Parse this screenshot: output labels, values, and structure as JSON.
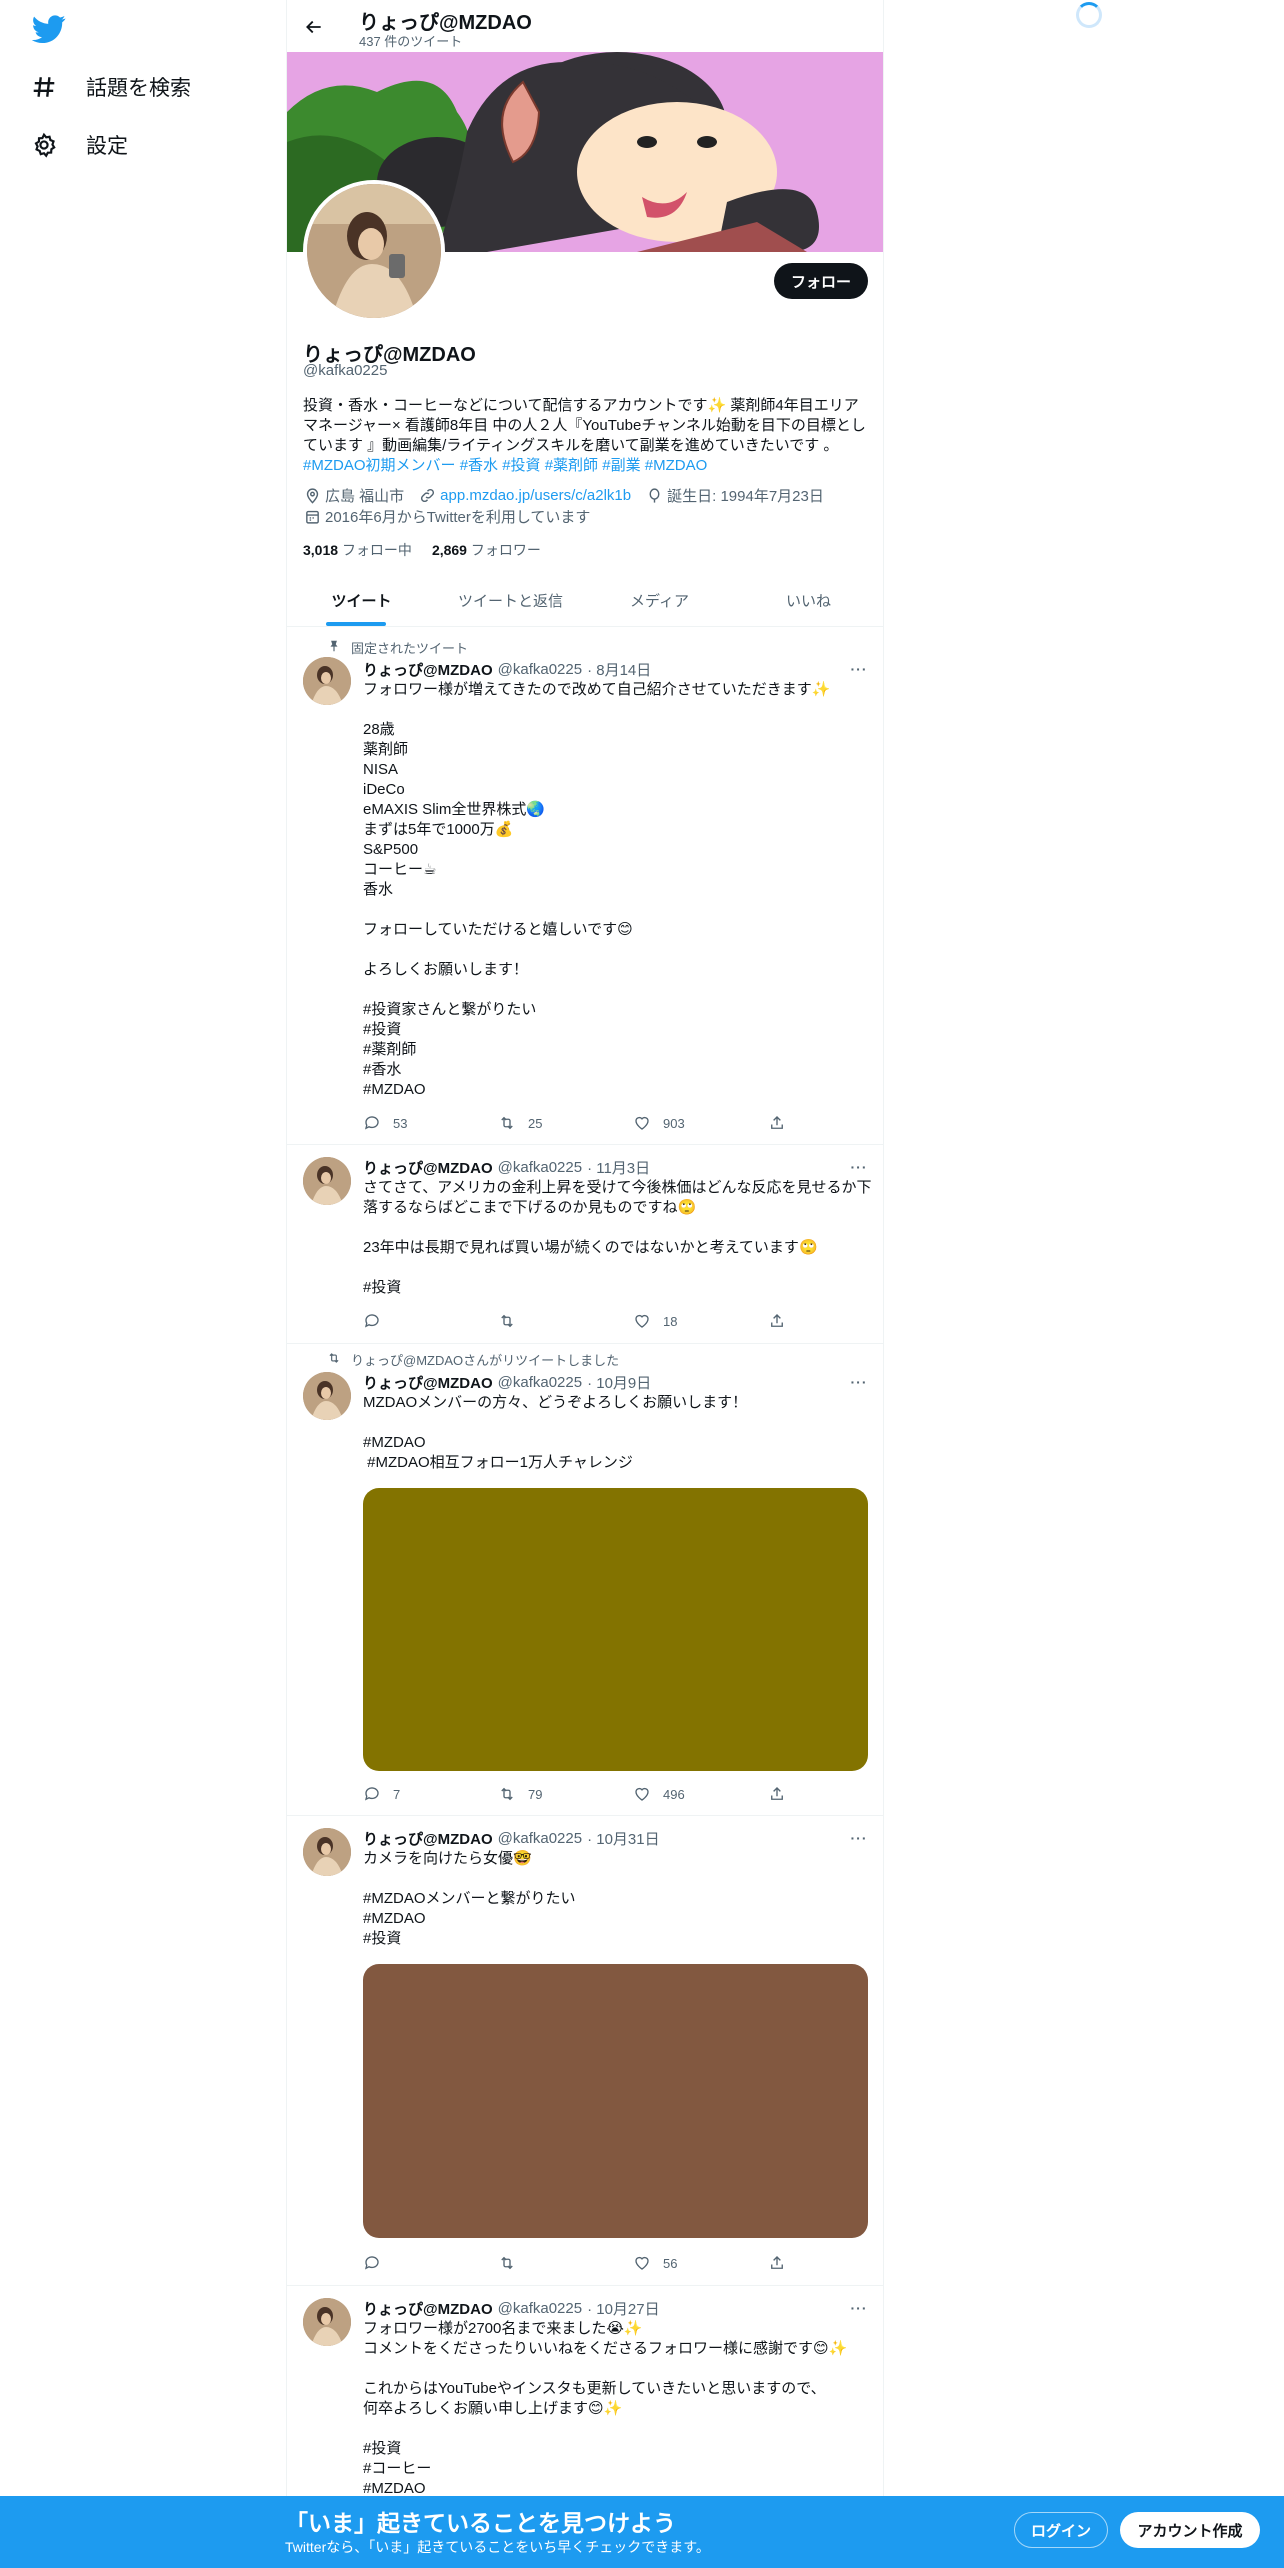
{
  "nav": {
    "logo": "twitter-bird-icon",
    "items": [
      {
        "icon": "hashtag-icon",
        "label": "話題を検索"
      },
      {
        "icon": "gear-icon",
        "label": "設定"
      }
    ]
  },
  "header": {
    "name": "りょっぴ@MZDAO",
    "tweet_count": "437 件のツイート"
  },
  "profile": {
    "name": "りょっぴ@MZDAO",
    "handle": "@kafka0225",
    "follow_button": "フォロー",
    "bio_text": "投資・香水・コーヒーなどについて配信するアカウントです✨ 薬剤師4年目エリアマネージャー× 看護師8年目 中の人２人『YouTubeチャンネル始動を目下の目標としています 』動画編集/ライティングスキルを磨いて副業を進めていきたいです 。",
    "bio_tags": [
      "#MZDAO初期メンバー",
      "#香水",
      "#投資",
      "#薬剤師",
      "#副業",
      "#MZDAO"
    ],
    "location": "広島 福山市",
    "url": "app.mzdao.jp/users/c/a2lk1b",
    "birthday": "誕生日: 1994年7月23日",
    "joined": "2016年6月からTwitterを利用しています",
    "following_count": "3,018",
    "following_label": "フォロー中",
    "followers_count": "2,869",
    "followers_label": "フォロワー"
  },
  "tabs": [
    "ツイート",
    "ツイートと返信",
    "メディア",
    "いいね"
  ],
  "tweets": [
    {
      "context": "固定されたツイート",
      "name": "りょっぴ@MZDAO",
      "handle": "@kafka0225",
      "date": "· 8月14日",
      "text": "フォロワー様が増えてきたので改めて自己紹介させていただきます✨\n\n28歳\n薬剤師\nNISA\niDeCo\neMAXIS Slim全世界株式🌏\nまずは5年で1000万💰\nS&P500\nコーヒー☕\n香水\n\nフォローしていただけると嬉しいです😊\n\nよろしくお願いします！",
      "tags": "#投資家さんと繋がりたい\n#投資\n#薬剤師\n#香水\n#MZDAO",
      "replies": "53",
      "retweets": "25",
      "likes": "903"
    },
    {
      "name": "りょっぴ@MZDAO",
      "handle": "@kafka0225",
      "date": "· 11月3日",
      "text": "さてさて、アメリカの金利上昇を受けて今後株価はどんな反応を見せるか下落するならばどこまで下げるのか見ものですね🙄\n\n23年中は長期で見れば買い場が続くのではないかと考えています🙄",
      "tags": "#投資",
      "replies": "",
      "retweets": "",
      "likes": "18"
    },
    {
      "context": "りょっぴ@MZDAOさんがリツイートしました",
      "name": "りょっぴ@MZDAO",
      "handle": "@kafka0225",
      "date": "· 10月9日",
      "text": "MZDAOメンバーの方々、どうぞよろしくお願いします！",
      "tags": "#MZDAO\n #MZDAO相互フォロー1万人チャレンジ",
      "media_color": "#837300",
      "replies": "7",
      "retweets": "79",
      "likes": "496"
    },
    {
      "name": "りょっぴ@MZDAO",
      "handle": "@kafka0225",
      "date": "· 10月31日",
      "text": "カメラを向けたら女優🤓",
      "tags": "#MZDAOメンバーと繋がりたい\n#MZDAO\n#投資",
      "media_color": "#825840",
      "replies": "",
      "retweets": "",
      "likes": "56"
    },
    {
      "name": "りょっぴ@MZDAO",
      "handle": "@kafka0225",
      "date": "· 10月27日",
      "text": "フォロワー様が2700名まで来ました😭✨\nコメントをくださったりいいねをくださるフォロワー様に感謝です😊✨\n\nこれからはYouTubeやインスタも更新していきたいと思いますので、\n何卒よろしくお願い申し上げます😊✨",
      "tags": "#投資\n#コーヒー\n#MZDAO"
    }
  ],
  "bottom": {
    "title": "「いま」起きていることを見つけよう",
    "subtitle": "Twitterなら、「いま」起きていることをいち早くチェックできます。",
    "login": "ログイン",
    "signup": "アカウント作成"
  },
  "colors": {
    "accent": "#1d9bf0",
    "text": "#0f1419",
    "muted": "#536471",
    "banner": "#e6a4e4"
  }
}
